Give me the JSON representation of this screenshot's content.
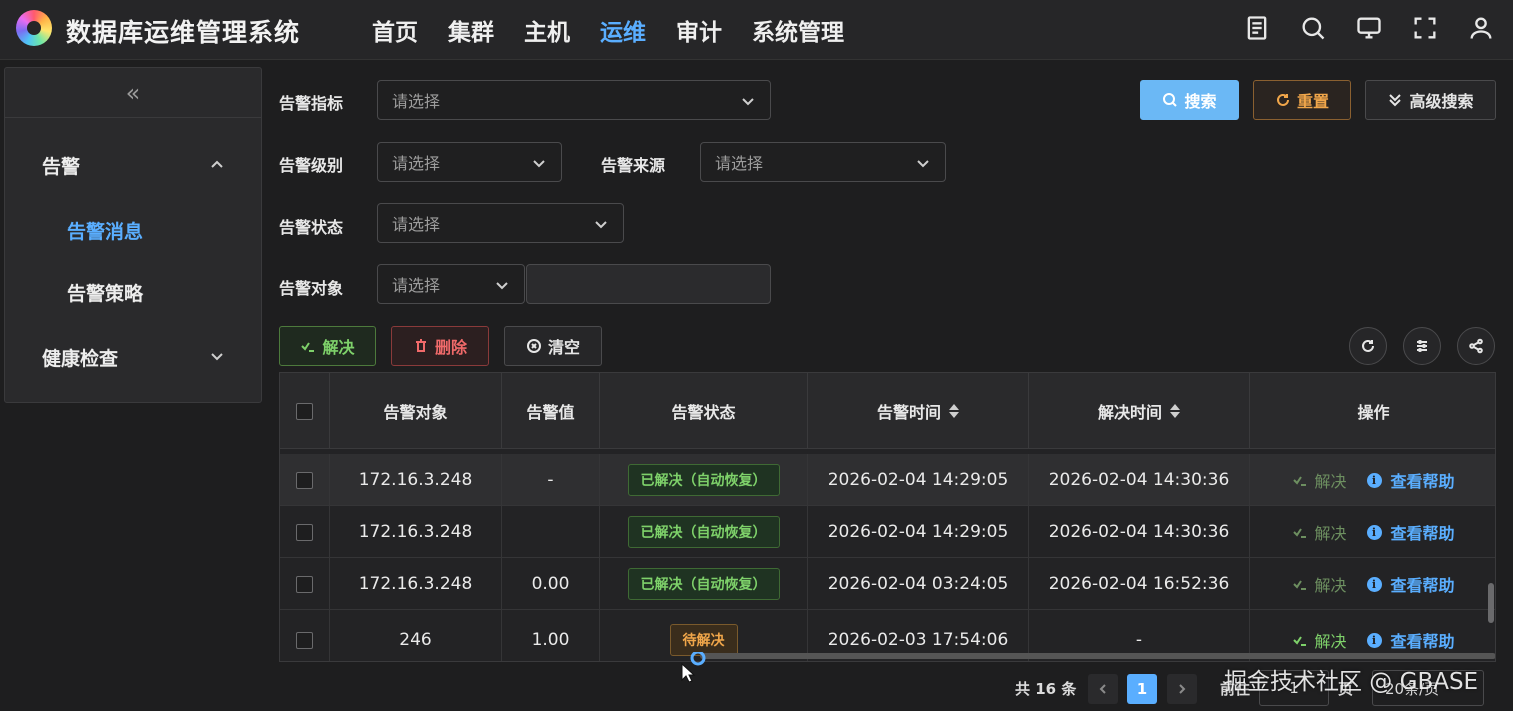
{
  "app": {
    "title": "数据库运维管理系统"
  },
  "nav": {
    "items": [
      {
        "label": "首页"
      },
      {
        "label": "集群"
      },
      {
        "label": "主机"
      },
      {
        "label": "运维",
        "active": true
      },
      {
        "label": "审计"
      },
      {
        "label": "系统管理"
      }
    ]
  },
  "top_icons": [
    "document-icon",
    "search-icon",
    "monitor-icon",
    "fullscreen-icon",
    "user-icon"
  ],
  "sidebar": {
    "collapse_glyph": "«",
    "groups": [
      {
        "label": "告警",
        "expanded": true,
        "items": [
          {
            "label": "告警消息",
            "active": true
          },
          {
            "label": "告警策略"
          }
        ]
      },
      {
        "label": "健康检查",
        "expanded": false
      }
    ]
  },
  "filters": {
    "metric": {
      "label": "告警指标",
      "placeholder": "请选择"
    },
    "level": {
      "label": "告警级别",
      "placeholder": "请选择"
    },
    "source": {
      "label": "告警来源",
      "placeholder": "请选择"
    },
    "status": {
      "label": "告警状态",
      "placeholder": "请选择"
    },
    "target": {
      "label": "告警对象",
      "placeholder": "请选择",
      "text_value": ""
    }
  },
  "actions": {
    "search": "搜索",
    "reset": "重置",
    "advanced": "高级搜索",
    "resolve": "解决",
    "delete": "删除",
    "clear": "清空"
  },
  "table": {
    "columns": [
      "告警对象",
      "告警值",
      "告警状态",
      "告警时间",
      "解决时间",
      "操作"
    ],
    "rows": [
      {
        "target": "172.16.3.248",
        "value": "-",
        "status": "已解决（自动恢复）",
        "status_type": "resolved",
        "alarm_time": "2026-02-04 14:29:05",
        "resolve_time": "2026-02-04 14:30:36",
        "op_resolve": "解决",
        "op_help": "查看帮助"
      },
      {
        "target": "172.16.3.248",
        "value": "",
        "status": "已解决（自动恢复）",
        "status_type": "resolved",
        "alarm_time": "2026-02-04 14:29:05",
        "resolve_time": "2026-02-04 14:30:36",
        "op_resolve": "解决",
        "op_help": "查看帮助"
      },
      {
        "target": "172.16.3.248",
        "value": "0.00",
        "status": "已解决（自动恢复）",
        "status_type": "resolved",
        "alarm_time": "2026-02-04 03:24:05",
        "resolve_time": "2026-02-04 16:52:36",
        "op_resolve": "解决",
        "op_help": "查看帮助"
      },
      {
        "target": "246",
        "value": "1.00",
        "status": "待解决",
        "status_type": "pending",
        "alarm_time": "2026-02-03 17:54:06",
        "resolve_time": "-",
        "op_resolve": "解决",
        "op_help": "查看帮助"
      }
    ]
  },
  "pagination": {
    "total": "共 16 条",
    "current_page": "1",
    "goto_label": "前往",
    "goto_value": "1",
    "page_suffix": "页",
    "page_size": "20条/页"
  },
  "watermark": "掘金技术社区 @ GBASE",
  "colors": {
    "accent": "#5aaeff",
    "resolved": "#7ed16a",
    "pending": "#f0a64a",
    "danger": "#f06a6a"
  }
}
